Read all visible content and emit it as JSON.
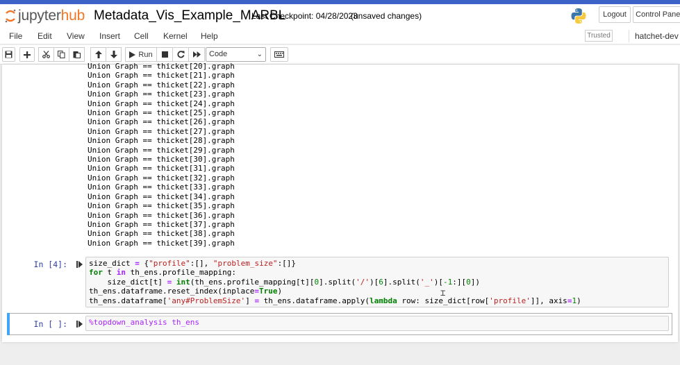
{
  "header": {
    "logo_text_main": "jupyter",
    "logo_text_accent": "hub",
    "notebook_title": "Metadata_Vis_Example_MARBL",
    "checkpoint": "Last Checkpoint: 04/28/2023",
    "save_status": "(unsaved changes)",
    "logout_label": "Logout",
    "control_panel_label": "Control Panel"
  },
  "menu": {
    "items": [
      "File",
      "Edit",
      "View",
      "Insert",
      "Cell",
      "Kernel",
      "Help"
    ],
    "trusted": "Trusted",
    "kernel": "hatchet-dev"
  },
  "toolbar": {
    "run_label": "Run",
    "cell_type": "Code"
  },
  "output": {
    "lines": [
      "Union Graph == thicket[20].graph",
      "Union Graph == thicket[21].graph",
      "Union Graph == thicket[22].graph",
      "Union Graph == thicket[23].graph",
      "Union Graph == thicket[24].graph",
      "Union Graph == thicket[25].graph",
      "Union Graph == thicket[26].graph",
      "Union Graph == thicket[27].graph",
      "Union Graph == thicket[28].graph",
      "Union Graph == thicket[29].graph",
      "Union Graph == thicket[30].graph",
      "Union Graph == thicket[31].graph",
      "Union Graph == thicket[32].graph",
      "Union Graph == thicket[33].graph",
      "Union Graph == thicket[34].graph",
      "Union Graph == thicket[35].graph",
      "Union Graph == thicket[36].graph",
      "Union Graph == thicket[37].graph",
      "Union Graph == thicket[38].graph",
      "Union Graph == thicket[39].graph"
    ]
  },
  "cells": [
    {
      "prompt": "In [4]:",
      "code": [
        [
          [
            "size_dict ",
            ""
          ],
          [
            "=",
            "op"
          ],
          [
            " {",
            ""
          ],
          [
            "\"profile\"",
            "str"
          ],
          [
            ":[], ",
            ""
          ],
          [
            "\"problem_size\"",
            "str"
          ],
          [
            ":[]}",
            ""
          ]
        ],
        [
          [
            "for",
            "kw"
          ],
          [
            " t ",
            ""
          ],
          [
            "in",
            "op"
          ],
          [
            " th_ens.profile_mapping:",
            ""
          ]
        ],
        [
          [
            "    size_dict[t] ",
            ""
          ],
          [
            "=",
            "op"
          ],
          [
            " ",
            ""
          ],
          [
            "int",
            "kw"
          ],
          [
            "(th_ens.profile_mapping[t][",
            ""
          ],
          [
            "0",
            "num"
          ],
          [
            "].split(",
            ""
          ],
          [
            "'/'",
            "str"
          ],
          [
            ")[",
            ""
          ],
          [
            "6",
            "num"
          ],
          [
            "].split(",
            ""
          ],
          [
            "'_'",
            "str"
          ],
          [
            ")[",
            ""
          ],
          [
            "-1",
            "num"
          ],
          [
            ":][",
            ""
          ],
          [
            "0",
            "num"
          ],
          [
            "])",
            ""
          ]
        ],
        [
          [
            "th_ens.dataframe.reset_index(inplace",
            ""
          ],
          [
            "=",
            "op"
          ],
          [
            "True",
            "kw"
          ],
          [
            ")",
            ""
          ]
        ],
        [
          [
            "th_ens.dataframe[",
            ""
          ],
          [
            "'any#ProblemSize'",
            "str"
          ],
          [
            "] ",
            ""
          ],
          [
            "=",
            "op"
          ],
          [
            " th_ens.dataframe.apply(",
            ""
          ],
          [
            "lambda",
            "kw"
          ],
          [
            " row: size_dict[row[",
            ""
          ],
          [
            "'profile'",
            "str"
          ],
          [
            "]], axis",
            ""
          ],
          [
            "=",
            "op"
          ],
          [
            "1",
            "num"
          ],
          [
            ")",
            ""
          ]
        ]
      ]
    },
    {
      "prompt": "In [ ]:",
      "code": [
        [
          [
            "%topdown_analysis th_ens",
            "magic"
          ]
        ]
      ]
    }
  ],
  "colors": {
    "accent_bar": "#3d63c9",
    "jupyter_orange": "#f37726",
    "prompt_blue": "#303f9f",
    "selected_cell": "#42a5f5"
  }
}
